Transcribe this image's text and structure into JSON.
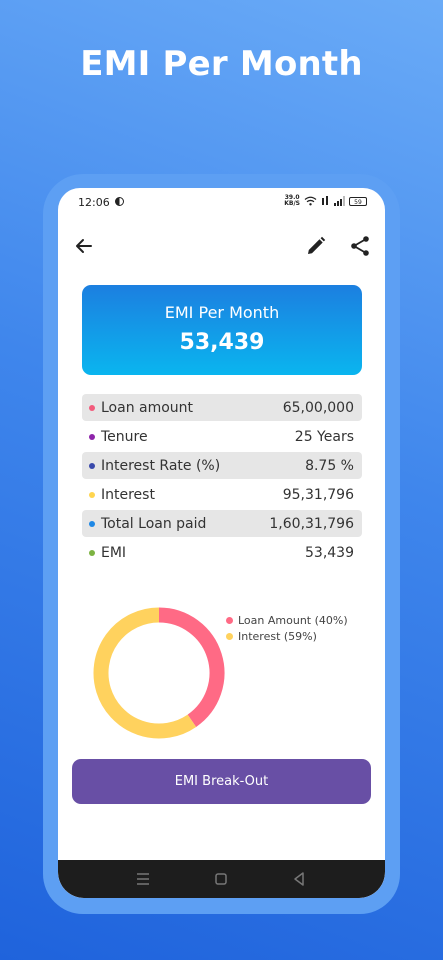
{
  "headline": "EMI Per Month",
  "status_bar": {
    "time": "12:06",
    "net_speed_value": "39.0",
    "net_speed_unit": "KB/S",
    "battery": "59"
  },
  "emi_card": {
    "label": "EMI Per Month",
    "value": "53,439"
  },
  "rows": [
    {
      "label": "Loan amount",
      "value": "65,00,000",
      "dot_color": "#f25b7c"
    },
    {
      "label": "Tenure",
      "value": "25 Years",
      "dot_color": "#8e24aa"
    },
    {
      "label": "Interest Rate (%)",
      "value": "8.75 %",
      "dot_color": "#3949ab"
    },
    {
      "label": "Interest",
      "value": "95,31,796",
      "dot_color": "#ffd54f"
    },
    {
      "label": "Total Loan paid",
      "value": "1,60,31,796",
      "dot_color": "#1e88e5"
    },
    {
      "label": "EMI",
      "value": "53,439",
      "dot_color": "#7cb342"
    }
  ],
  "chart_data": {
    "type": "pie",
    "categories": [
      "Loan Amount (40%)",
      "Interest (59%)"
    ],
    "values": [
      40,
      59
    ],
    "colors": [
      "#ff6a85",
      "#ffd25e"
    ],
    "legend": "right"
  },
  "breakout_button": "EMI Break-Out",
  "colors": {
    "accent_button": "#684fa5",
    "card_top": "#1c7fe0",
    "card_bottom": "#0ab5ef"
  }
}
